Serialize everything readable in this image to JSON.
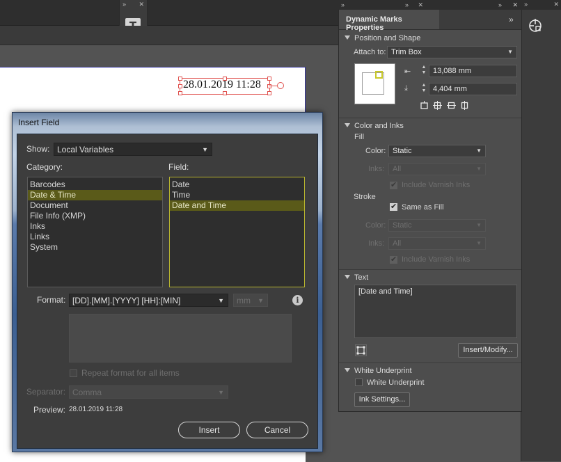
{
  "app": {
    "dock_controls": {
      "collapse": "»",
      "close": "✕"
    },
    "tools": [
      {
        "name": "text-tool",
        "icon": "text-frame-icon",
        "glyph": "T"
      },
      {
        "name": "dynamic-marks-tool",
        "icon": "crosshair-gear-icon"
      }
    ]
  },
  "document": {
    "date_text": "28.01.2019 11:28"
  },
  "dialog": {
    "title": "Insert Field",
    "show_label": "Show:",
    "show_value": "Local Variables",
    "category_label": "Category:",
    "field_label": "Field:",
    "categories": [
      "Barcodes",
      "Date & Time",
      "Document",
      "File Info (XMP)",
      "Inks",
      "Links",
      "System"
    ],
    "selected_category": 1,
    "fields": [
      "Date",
      "Time",
      "Date and Time"
    ],
    "selected_field": 2,
    "format_label": "Format:",
    "format_value": "[DD].[MM].[YYYY] [HH]:[MIN]",
    "unit_value": "mm",
    "info_glyph": "i",
    "repeat_label": "Repeat format for all items",
    "separator_label": "Separator:",
    "separator_value": "Comma",
    "preview_label": "Preview:",
    "preview_value": "28.01.2019 11:28",
    "insert_label": "Insert",
    "cancel_label": "Cancel"
  },
  "panel": {
    "title": "Dynamic Marks Properties",
    "menu_glyph": "»",
    "position_section": "Position and Shape",
    "attach_label": "Attach to:",
    "attach_value": "Trim Box",
    "x_offset": "13,088 mm",
    "y_offset": "4,404 mm",
    "color_section": "Color and Inks",
    "fill_label": "Fill",
    "fill_color_label": "Color:",
    "fill_color_value": "Static",
    "fill_inks_label": "Inks:",
    "fill_inks_value": "All",
    "fill_varnish_label": "Include Varnish Inks",
    "stroke_label": "Stroke",
    "same_as_fill_label": "Same as Fill",
    "stroke_color_label": "Color:",
    "stroke_color_value": "Static",
    "stroke_inks_label": "Inks:",
    "stroke_inks_value": "All",
    "stroke_varnish_label": "Include Varnish Inks",
    "text_section": "Text",
    "text_value": "[Date and Time]",
    "insert_modify_label": "Insert/Modify...",
    "underprint_section": "White Underprint",
    "underprint_label": "White Underprint",
    "ink_settings_label": "Ink Settings...",
    "accent_color": "#c8c82a"
  }
}
